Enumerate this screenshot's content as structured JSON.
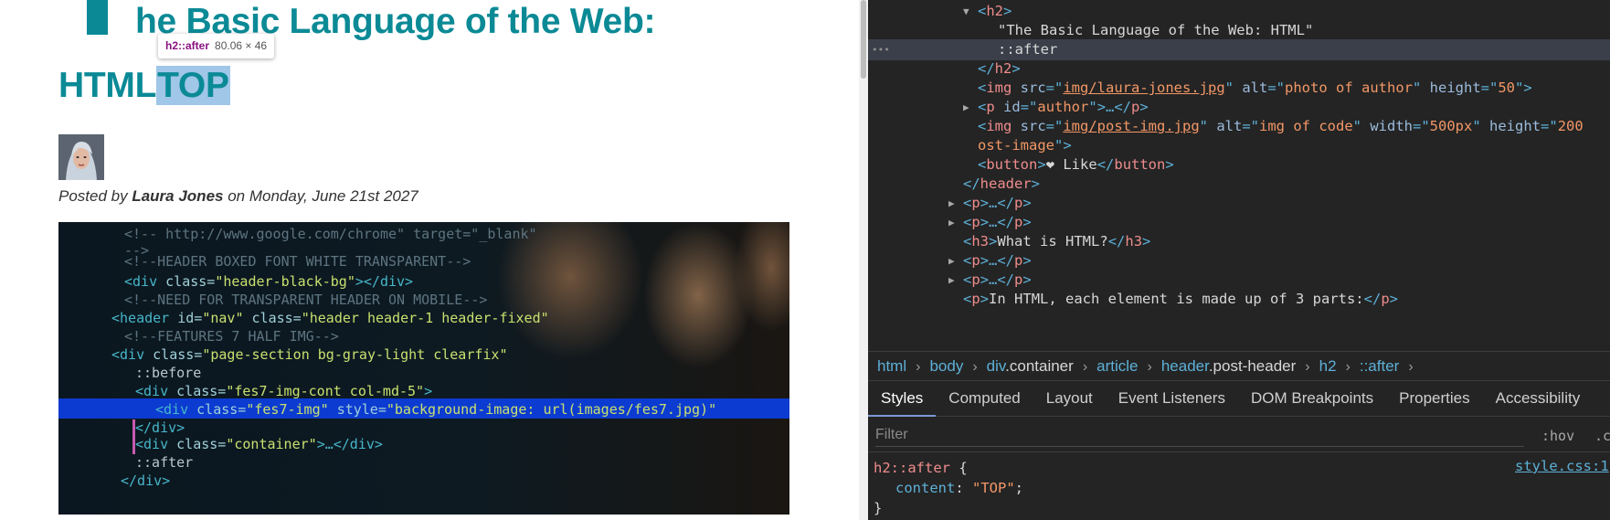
{
  "page": {
    "title_line1": "he Basic Language of the Web:",
    "title_line2": "HTML",
    "after_content": "TOP",
    "tooltip": {
      "name": "h2::after",
      "size": "80.06 × 46"
    },
    "byline": {
      "prefix": "Posted by ",
      "author": "Laura Jones",
      "suffix": " on Monday, June 21st 2027"
    },
    "post_image": {
      "lines": [
        {
          "parts": [
            {
              "c": "c-com",
              "t": "<!--  http://www.google.com/chrome\" target=\"_blank\""
            }
          ]
        },
        {
          "parts": [
            {
              "c": "c-com",
              "t": "-->"
            }
          ]
        },
        {
          "parts": [
            {
              "c": "c-com",
              "t": "<!--HEADER BOXED FONT WHITE TRANSPARENT-->"
            }
          ]
        },
        {
          "parts": [
            {
              "c": "c-tag",
              "t": "<div "
            },
            {
              "c": "c-attr",
              "t": "class="
            },
            {
              "c": "c-str",
              "t": "\"header-black-bg\""
            },
            {
              "c": "c-tag",
              "t": "></div>"
            }
          ]
        },
        {
          "parts": [
            {
              "c": "c-com",
              "t": "<!--NEED FOR TRANSPARENT HEADER ON MOBILE-->"
            }
          ]
        },
        {
          "parts": [
            {
              "c": "c-tag",
              "t": "<header "
            },
            {
              "c": "c-attr",
              "t": "id="
            },
            {
              "c": "c-str",
              "t": "\"nav\" "
            },
            {
              "c": "c-attr",
              "t": "class="
            },
            {
              "c": "c-str",
              "t": "\"header header-1 header-fixed\""
            }
          ]
        },
        {
          "parts": [
            {
              "c": "c-com",
              "t": "<!--FEATURES 7 HALF IMG-->"
            }
          ]
        },
        {
          "parts": [
            {
              "c": "c-tag",
              "t": "<div "
            },
            {
              "c": "c-attr",
              "t": "class="
            },
            {
              "c": "c-str",
              "t": "\"page-section bg-gray-light clearfix\""
            }
          ]
        },
        {
          "parts": [
            {
              "c": "c-txt",
              "t": "  ::before"
            }
          ]
        },
        {
          "parts": [
            {
              "c": "c-tag",
              "t": "<div "
            },
            {
              "c": "c-attr",
              "t": "class="
            },
            {
              "c": "c-str",
              "t": "\"fes7-img-cont col-md-5\""
            },
            {
              "c": "c-tag",
              "t": ">"
            }
          ]
        },
        {
          "parts": [
            {
              "c": "c-tag",
              "t": "  <div "
            },
            {
              "c": "c-attr",
              "t": "class="
            },
            {
              "c": "c-str",
              "t": "\"fes7-img\" "
            },
            {
              "c": "c-attr",
              "t": "style="
            },
            {
              "c": "c-str",
              "t": "\"background-image: url(images/fes7.jpg)\""
            }
          ]
        },
        {
          "parts": [
            {
              "c": "c-tag",
              "t": "</div>"
            }
          ]
        },
        {
          "parts": [
            {
              "c": "c-tag",
              "t": "<div "
            },
            {
              "c": "c-attr",
              "t": "class="
            },
            {
              "c": "c-str",
              "t": "\"container\""
            },
            {
              "c": "c-tag",
              "t": ">…</div>"
            }
          ]
        },
        {
          "parts": [
            {
              "c": "c-txt",
              "t": "  ::after"
            }
          ]
        },
        {
          "parts": [
            {
              "c": "c-tag",
              "t": "</div>"
            }
          ]
        }
      ]
    }
  },
  "devtools": {
    "dom_lines": [
      {
        "triangle": "▼",
        "parts": [
          {
            "c": "t",
            "t": "<"
          },
          {
            "c": "tn",
            "t": "h2"
          },
          {
            "c": "t",
            "t": ">"
          }
        ]
      },
      {
        "parts": [
          {
            "c": "txt",
            "t": "\"The Basic Language of the Web: HTML\""
          }
        ]
      },
      {
        "selected": true,
        "parts": [
          {
            "c": "txt",
            "t": "::after"
          }
        ]
      },
      {
        "parts": [
          {
            "c": "t",
            "t": "</"
          },
          {
            "c": "tn",
            "t": "h2"
          },
          {
            "c": "t",
            "t": ">"
          }
        ]
      },
      {
        "parts": [
          {
            "c": "t",
            "t": "<"
          },
          {
            "c": "tn",
            "t": "img "
          },
          {
            "c": "an",
            "t": "src"
          },
          {
            "c": "t",
            "t": "=\""
          },
          {
            "c": "link",
            "t": "img/laura-jones.jpg"
          },
          {
            "c": "t",
            "t": "\" "
          },
          {
            "c": "an",
            "t": "alt"
          },
          {
            "c": "t",
            "t": "=\""
          },
          {
            "c": "av",
            "t": "photo of author"
          },
          {
            "c": "t",
            "t": "\" "
          },
          {
            "c": "an",
            "t": "height"
          },
          {
            "c": "t",
            "t": "=\""
          },
          {
            "c": "av",
            "t": "50"
          },
          {
            "c": "t",
            "t": "\">"
          }
        ]
      },
      {
        "triangle": "▶",
        "parts": [
          {
            "c": "t",
            "t": "<"
          },
          {
            "c": "tn",
            "t": "p "
          },
          {
            "c": "an",
            "t": "id"
          },
          {
            "c": "t",
            "t": "=\""
          },
          {
            "c": "av",
            "t": "author"
          },
          {
            "c": "t",
            "t": "\">…</"
          },
          {
            "c": "tn",
            "t": "p"
          },
          {
            "c": "t",
            "t": ">"
          }
        ]
      },
      {
        "parts": [
          {
            "c": "t",
            "t": "<"
          },
          {
            "c": "tn",
            "t": "img "
          },
          {
            "c": "an",
            "t": "src"
          },
          {
            "c": "t",
            "t": "=\""
          },
          {
            "c": "link",
            "t": "img/post-img.jpg"
          },
          {
            "c": "t",
            "t": "\" "
          },
          {
            "c": "an",
            "t": "alt"
          },
          {
            "c": "t",
            "t": "=\""
          },
          {
            "c": "av",
            "t": "img of code"
          },
          {
            "c": "t",
            "t": "\" "
          },
          {
            "c": "an",
            "t": "width"
          },
          {
            "c": "t",
            "t": "=\""
          },
          {
            "c": "av",
            "t": "500px"
          },
          {
            "c": "t",
            "t": "\" "
          },
          {
            "c": "an",
            "t": "height"
          },
          {
            "c": "t",
            "t": "=\""
          },
          {
            "c": "av",
            "t": "200"
          }
        ]
      },
      {
        "parts": [
          {
            "c": "av",
            "t": "ost-image"
          },
          {
            "c": "t",
            "t": "\">"
          }
        ]
      },
      {
        "parts": [
          {
            "c": "t",
            "t": "<"
          },
          {
            "c": "tn",
            "t": "button"
          },
          {
            "c": "t",
            "t": ">"
          },
          {
            "c": "txt",
            "t": "❤ Like"
          },
          {
            "c": "t",
            "t": "</"
          },
          {
            "c": "tn",
            "t": "button"
          },
          {
            "c": "t",
            "t": ">"
          }
        ]
      },
      {
        "parts": [
          {
            "c": "t",
            "t": "</"
          },
          {
            "c": "tn",
            "t": "header"
          },
          {
            "c": "t",
            "t": ">"
          }
        ]
      },
      {
        "triangle": "▶",
        "parts": [
          {
            "c": "t",
            "t": "<"
          },
          {
            "c": "tn",
            "t": "p"
          },
          {
            "c": "t",
            "t": ">…</"
          },
          {
            "c": "tn",
            "t": "p"
          },
          {
            "c": "t",
            "t": ">"
          }
        ]
      },
      {
        "triangle": "▶",
        "parts": [
          {
            "c": "t",
            "t": "<"
          },
          {
            "c": "tn",
            "t": "p"
          },
          {
            "c": "t",
            "t": ">…</"
          },
          {
            "c": "tn",
            "t": "p"
          },
          {
            "c": "t",
            "t": ">"
          }
        ]
      },
      {
        "parts": [
          {
            "c": "t",
            "t": "<"
          },
          {
            "c": "tn",
            "t": "h3"
          },
          {
            "c": "t",
            "t": ">"
          },
          {
            "c": "txt",
            "t": "What is HTML?"
          },
          {
            "c": "t",
            "t": "</"
          },
          {
            "c": "tn",
            "t": "h3"
          },
          {
            "c": "t",
            "t": ">"
          }
        ]
      },
      {
        "triangle": "▶",
        "parts": [
          {
            "c": "t",
            "t": "<"
          },
          {
            "c": "tn",
            "t": "p"
          },
          {
            "c": "t",
            "t": ">…</"
          },
          {
            "c": "tn",
            "t": "p"
          },
          {
            "c": "t",
            "t": ">"
          }
        ]
      },
      {
        "triangle": "▶",
        "parts": [
          {
            "c": "t",
            "t": "<"
          },
          {
            "c": "tn",
            "t": "p"
          },
          {
            "c": "t",
            "t": ">…</"
          },
          {
            "c": "tn",
            "t": "p"
          },
          {
            "c": "t",
            "t": ">"
          }
        ]
      },
      {
        "parts": [
          {
            "c": "t",
            "t": "<"
          },
          {
            "c": "tn",
            "t": "p"
          },
          {
            "c": "t",
            "t": ">"
          },
          {
            "c": "txt",
            "t": "In HTML, each element is made up of 3 parts:"
          },
          {
            "c": "t",
            "t": "</"
          },
          {
            "c": "tn",
            "t": "p"
          },
          {
            "c": "t",
            "t": ">"
          }
        ]
      }
    ],
    "breadcrumb": [
      {
        "tag": "html",
        "cls": ""
      },
      {
        "tag": "body",
        "cls": ""
      },
      {
        "tag": "div",
        "cls": ".container"
      },
      {
        "tag": "article",
        "cls": ""
      },
      {
        "tag": "header",
        "cls": ".post-header"
      },
      {
        "tag": "h2",
        "cls": ""
      },
      {
        "tag": "::after",
        "cls": ""
      }
    ],
    "tabs": [
      "Styles",
      "Computed",
      "Layout",
      "Event Listeners",
      "DOM Breakpoints",
      "Properties",
      "Accessibility"
    ],
    "active_tab": "Styles",
    "filter_placeholder": "Filter",
    "hov_label": ":hov",
    "cls_label": ".cls",
    "rule": {
      "selector": "h2::after",
      "open_brace": " {",
      "property": "content",
      "value": "\"TOP\"",
      "close_brace": "}",
      "source": "style.css:1"
    }
  }
}
